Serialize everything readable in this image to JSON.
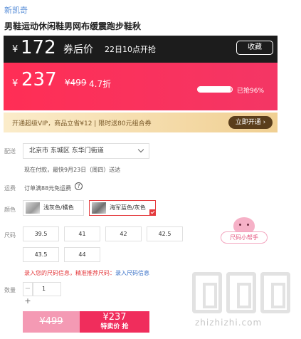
{
  "header": {
    "brand": "新凯奇",
    "product_title": "男鞋运动休闲鞋男网布缓震跑步鞋秋"
  },
  "price_banner": {
    "currency": "¥",
    "coupon_price": "172",
    "coupon_label": "券后价",
    "start_time": "22日10点开抢",
    "collect_label": "收藏",
    "promo_price": "237",
    "original_price": "¥499",
    "discount": "4.7折",
    "sold_percent": 96,
    "sold_label": "已抢96%"
  },
  "vip_bar": {
    "text": "开通超级VIP，商品立省¥12 | 限时送80元组合券",
    "button_label": "立即开通 ›"
  },
  "delivery": {
    "label": "配送",
    "address": "北京市 东城区 东华门街道",
    "ship_note": "现在付款，最快9月23日（周四）送达"
  },
  "freight": {
    "label": "运费",
    "text": "订单满88元免运费",
    "help_glyph": "?"
  },
  "color": {
    "label": "颜色",
    "options": [
      {
        "name": "浅灰色/橘色",
        "selected": false
      },
      {
        "name": "海军蓝色/灰色",
        "selected": true
      }
    ]
  },
  "size": {
    "label": "尺码",
    "options": [
      "39.5",
      "41",
      "42",
      "42.5",
      "43.5",
      "44"
    ],
    "helper_label": "尺码小帮手",
    "note_prefix": "录入您的尺码信息，精准推荐尺码：",
    "note_link": "录入尺码信息"
  },
  "quantity": {
    "label": "数量",
    "value": "1",
    "minus": "−",
    "plus": "+"
  },
  "buy": {
    "original_price": "¥499",
    "deal_price": "¥237",
    "deal_label": "特卖价 抢"
  },
  "watermark": {
    "text": "zhizhizhi.com"
  },
  "colors": {
    "accent_red": "#f02d5c",
    "dark_band": "#1c1c1c",
    "vip_gold": "#f0cf92",
    "link_blue": "#3a72c8"
  }
}
